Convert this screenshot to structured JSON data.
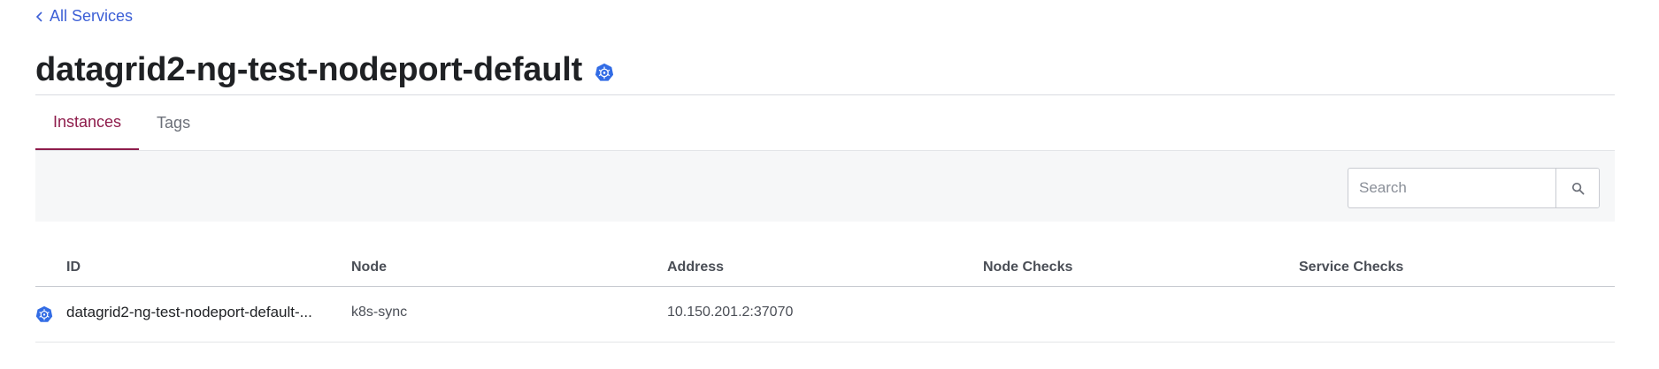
{
  "nav": {
    "back_label": "All Services"
  },
  "header": {
    "title": "datagrid2-ng-test-nodeport-default",
    "badge_icon": "kubernetes-icon"
  },
  "tabs": [
    {
      "label": "Instances",
      "active": true
    },
    {
      "label": "Tags",
      "active": false
    }
  ],
  "search": {
    "placeholder": "Search",
    "value": ""
  },
  "table": {
    "columns": [
      "ID",
      "Node",
      "Address",
      "Node Checks",
      "Service Checks"
    ],
    "rows": [
      {
        "icon": "kubernetes-icon",
        "id": "datagrid2-ng-test-nodeport-default-...",
        "node": "k8s-sync",
        "address": "10.150.201.2:37070",
        "node_checks": "",
        "service_checks": ""
      }
    ]
  },
  "colors": {
    "link": "#3c5fd6",
    "accent": "#8e1c4b",
    "kubernetes": "#326ce5",
    "toolbar_bg": "#f6f7f8"
  }
}
